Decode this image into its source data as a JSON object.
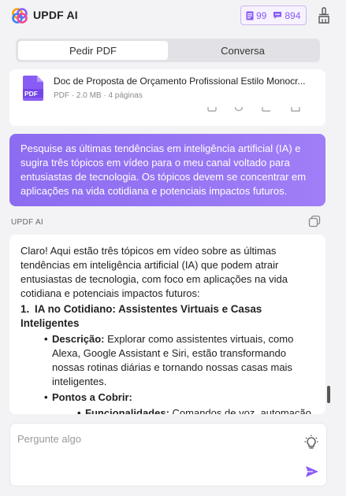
{
  "app": {
    "title": "UPDF AI"
  },
  "quota": {
    "pdf_count": "99",
    "chat_count": "894"
  },
  "tabs": [
    {
      "label": "Pedir PDF",
      "active": true
    },
    {
      "label": "Conversa",
      "active": false
    }
  ],
  "document": {
    "name": "Doc de Proposta de Orçamento Profissional Estilo Monocr...",
    "meta": "PDF · 2.0 MB · 4 páginas",
    "thumb_label": "PDF"
  },
  "user_message": "Pesquise as últimas tendências em inteligência artificial (IA) e sugira três tópicos em vídeo para o meu canal voltado para entusiastas de tecnologia. Os tópicos devem se concentrar em aplicações na vida cotidiana e potenciais impactos futuros.",
  "ai": {
    "label": "UPDF AI",
    "intro": "Claro! Aqui estão três tópicos em vídeo sobre as últimas tendências em inteligência artificial (IA) que podem atrair entusiastas de tecnologia, com foco em aplicações na vida cotidiana e potenciais impactos futuros:",
    "item1_num": "1.",
    "item1_title": "IA no Cotidiano: Assistentes Virtuais e Casas Inteligentes",
    "desc_label": "Descrição:",
    "desc_text": " Explorar como assistentes virtuais, como Alexa, Google Assistant e Siri, estão transformando nossas rotinas diárias e tornando nossas casas mais inteligentes.",
    "points_label": "Pontos a Cobrir:",
    "func_label": "Funcionalidades:",
    "func_text": " Comandos de voz, automação de tarefas, controle de dispositivos domésticos."
  },
  "input": {
    "placeholder": "Pergunte algo"
  },
  "colors": {
    "accent": "#8a5cf6",
    "user_bubble_start": "#8c6cf0",
    "user_bubble_end": "#a07ef7"
  }
}
